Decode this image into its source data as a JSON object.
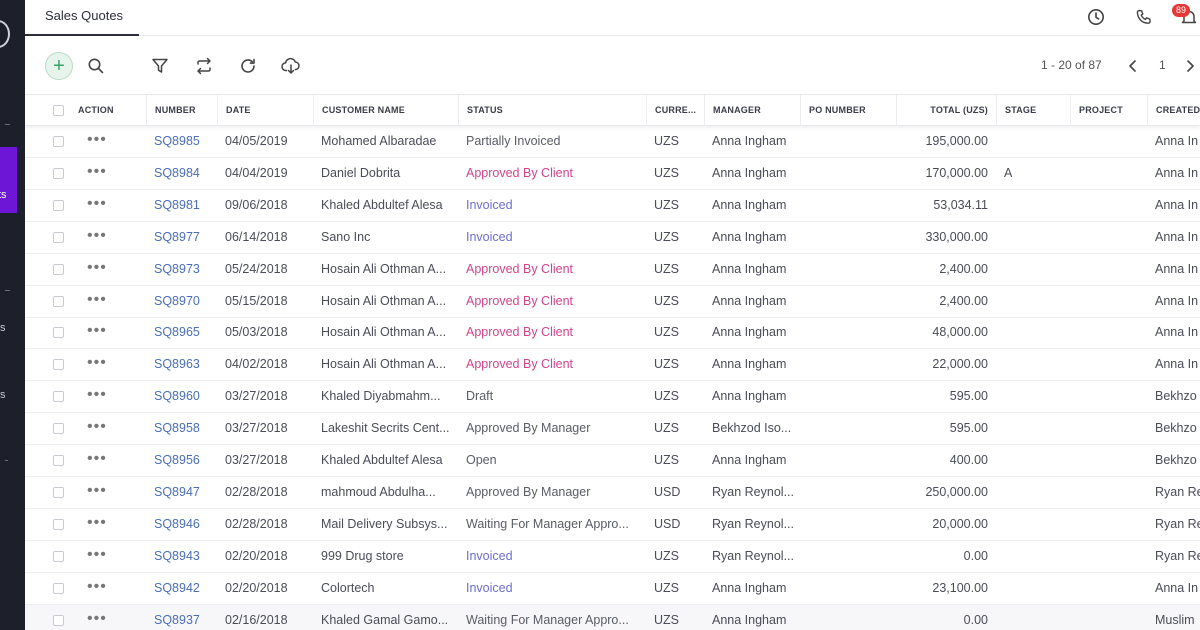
{
  "tabs": [
    {
      "label": "Sales Quotes"
    }
  ],
  "header": {
    "notification_count": "89"
  },
  "sidebar": {
    "fragments": [
      {
        "text": "ts"
      },
      {
        "text": "s"
      },
      {
        "text": "s"
      }
    ]
  },
  "pager": {
    "range_text": "1 - 20 of 87",
    "page": "1"
  },
  "colors": {
    "accent": "#6d16d6",
    "link": "#4a6fb5",
    "approved": "#d0458c",
    "invoiced": "#6d6fc9",
    "add": "#35a466"
  },
  "icons": [
    "clock-icon",
    "phone-icon",
    "bell-icon",
    "plus-icon",
    "search-icon",
    "filter-icon",
    "swap-icon",
    "refresh-icon",
    "download-icon",
    "chevron-left-icon",
    "chevron-right-icon",
    "more-icon"
  ],
  "table": {
    "columns": [
      {
        "label": "ACTION"
      },
      {
        "label": "NUMBER"
      },
      {
        "label": "DATE"
      },
      {
        "label": "CUSTOMER NAME"
      },
      {
        "label": "STATUS"
      },
      {
        "label": "CURRE..."
      },
      {
        "label": "MANAGER"
      },
      {
        "label": "PO NUMBER"
      },
      {
        "label": "TOTAL (UZS)"
      },
      {
        "label": "STAGE"
      },
      {
        "label": "PROJECT"
      },
      {
        "label": "CREATED"
      }
    ],
    "rows": [
      {
        "number": "SQ8985",
        "date": "04/05/2019",
        "customer": "Mohamed Albaradae",
        "status": "Partially Invoiced",
        "status_type": "default",
        "currency": "UZS",
        "manager": "Anna Ingham",
        "po_number": "",
        "total": "195,000.00",
        "stage": "",
        "project": "",
        "created": "Anna In"
      },
      {
        "number": "SQ8984",
        "date": "04/04/2019",
        "customer": "Daniel Dobrita",
        "status": "Approved By Client",
        "status_type": "approved_by_client",
        "currency": "UZS",
        "manager": "Anna Ingham",
        "po_number": "",
        "total": "170,000.00",
        "stage": "A",
        "project": "",
        "created": "Anna In"
      },
      {
        "number": "SQ8981",
        "date": "09/06/2018",
        "customer": "Khaled Abdultef Alesa",
        "status": "Invoiced",
        "status_type": "invoiced",
        "currency": "UZS",
        "manager": "Anna Ingham",
        "po_number": "",
        "total": "53,034.11",
        "stage": "",
        "project": "",
        "created": "Anna In"
      },
      {
        "number": "SQ8977",
        "date": "06/14/2018",
        "customer": "Sano Inc",
        "status": "Invoiced",
        "status_type": "invoiced",
        "currency": "UZS",
        "manager": "Anna Ingham",
        "po_number": "",
        "total": "330,000.00",
        "stage": "",
        "project": "",
        "created": "Anna In"
      },
      {
        "number": "SQ8973",
        "date": "05/24/2018",
        "customer": "Hosain Ali Othman A...",
        "status": "Approved By Client",
        "status_type": "approved_by_client",
        "currency": "UZS",
        "manager": "Anna Ingham",
        "po_number": "",
        "total": "2,400.00",
        "stage": "",
        "project": "",
        "created": "Anna In"
      },
      {
        "number": "SQ8970",
        "date": "05/15/2018",
        "customer": "Hosain Ali Othman A...",
        "status": "Approved By Client",
        "status_type": "approved_by_client",
        "currency": "UZS",
        "manager": "Anna Ingham",
        "po_number": "",
        "total": "2,400.00",
        "stage": "",
        "project": "",
        "created": "Anna In"
      },
      {
        "number": "SQ8965",
        "date": "05/03/2018",
        "customer": "Hosain Ali Othman A...",
        "status": "Approved By Client",
        "status_type": "approved_by_client",
        "currency": "UZS",
        "manager": "Anna Ingham",
        "po_number": "",
        "total": "48,000.00",
        "stage": "",
        "project": "",
        "created": "Anna In"
      },
      {
        "number": "SQ8963",
        "date": "04/02/2018",
        "customer": "Hosain Ali Othman A...",
        "status": "Approved By Client",
        "status_type": "approved_by_client",
        "currency": "UZS",
        "manager": "Anna Ingham",
        "po_number": "",
        "total": "22,000.00",
        "stage": "",
        "project": "",
        "created": "Anna In"
      },
      {
        "number": "SQ8960",
        "date": "03/27/2018",
        "customer": "Khaled Diyabmahm...",
        "status": "Draft",
        "status_type": "default",
        "currency": "UZS",
        "manager": "Anna Ingham",
        "po_number": "",
        "total": "595.00",
        "stage": "",
        "project": "",
        "created": "Bekhzo"
      },
      {
        "number": "SQ8958",
        "date": "03/27/2018",
        "customer": "Lakeshit Secrits Cent...",
        "status": "Approved By Manager",
        "status_type": "default",
        "currency": "UZS",
        "manager": "Bekhzod Iso...",
        "po_number": "",
        "total": "595.00",
        "stage": "",
        "project": "",
        "created": "Bekhzo"
      },
      {
        "number": "SQ8956",
        "date": "03/27/2018",
        "customer": "Khaled Abdultef Alesa",
        "status": "Open",
        "status_type": "default",
        "currency": "UZS",
        "manager": "Anna Ingham",
        "po_number": "",
        "total": "400.00",
        "stage": "",
        "project": "",
        "created": "Bekhzo"
      },
      {
        "number": "SQ8947",
        "date": "02/28/2018",
        "customer": "mahmoud Abdulha...",
        "status": "Approved By Manager",
        "status_type": "default",
        "currency": "USD",
        "manager": "Ryan Reynol...",
        "po_number": "",
        "total": "250,000.00",
        "stage": "",
        "project": "",
        "created": "Ryan Re"
      },
      {
        "number": "SQ8946",
        "date": "02/28/2018",
        "customer": "Mail Delivery Subsys...",
        "status": "Waiting For Manager Appro...",
        "status_type": "default",
        "currency": "USD",
        "manager": "Ryan Reynol...",
        "po_number": "",
        "total": "20,000.00",
        "stage": "",
        "project": "",
        "created": "Ryan Re"
      },
      {
        "number": "SQ8943",
        "date": "02/20/2018",
        "customer": "999 Drug store",
        "status": "Invoiced",
        "status_type": "invoiced",
        "currency": "UZS",
        "manager": "Ryan Reynol...",
        "po_number": "",
        "total": "0.00",
        "stage": "",
        "project": "",
        "created": "Ryan Re"
      },
      {
        "number": "SQ8942",
        "date": "02/20/2018",
        "customer": "Colortech",
        "status": "Invoiced",
        "status_type": "invoiced",
        "currency": "UZS",
        "manager": "Anna Ingham",
        "po_number": "",
        "total": "23,100.00",
        "stage": "",
        "project": "",
        "created": "Anna In"
      },
      {
        "number": "SQ8937",
        "date": "02/16/2018",
        "customer": "Khaled Gamal Gamo...",
        "status": "Waiting For Manager Appro...",
        "status_type": "default",
        "currency": "UZS",
        "manager": "Anna Ingham",
        "po_number": "",
        "total": "0.00",
        "stage": "",
        "project": "",
        "created": "Muslim"
      }
    ]
  }
}
